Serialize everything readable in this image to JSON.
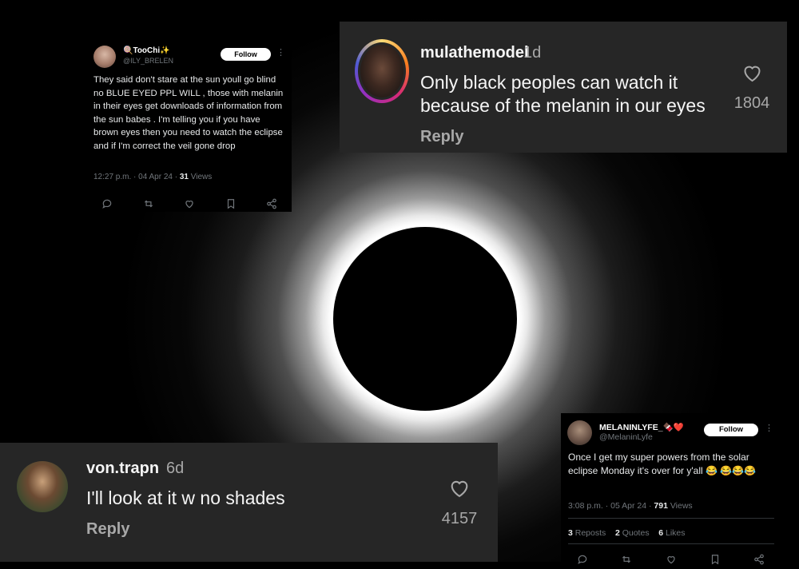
{
  "tweet1": {
    "name": "🍭TooChi✨",
    "handle": "@ILY_BRELEN",
    "follow_label": "Follow",
    "text": "They said don't stare at the sun youll go blind no BLUE EYED PPL WILL , those with melanin in their eyes get downloads of information from the sun babes . I'm telling you if you have brown eyes then you need to watch the eclipse and if I'm correct the veil gone drop",
    "time": "12:27 p.m. · 04 Apr 24 · ",
    "views_count": "31",
    "views_label": " Views"
  },
  "tweet2": {
    "name": "MELANINLYFE_🍫❤️",
    "handle": "@MelaninLyfe",
    "follow_label": "Follow",
    "text": "Once I get my super powers from the solar eclipse Monday it's over for y'all 😂 😂😂😂",
    "time": "3:08 p.m. · 05 Apr 24 · ",
    "views_count": "791",
    "views_label": " Views",
    "reposts_count": "3",
    "reposts_label": " Reposts",
    "quotes_count": "2",
    "quotes_label": " Quotes",
    "likes_count": "6",
    "likes_label": " Likes"
  },
  "comment1": {
    "username": "mulathemodel",
    "age": "1d",
    "text": "Only black peoples can watch it because of the melanin in our eyes",
    "reply_label": "Reply",
    "likes": "1804"
  },
  "comment2": {
    "username": "von.trapn",
    "age": "6d",
    "text": "I'll look at it w no shades",
    "reply_label": "Reply",
    "likes": "4157"
  },
  "icons": [
    "reply-icon",
    "retweet-icon",
    "like-icon",
    "bookmark-icon",
    "share-icon",
    "heart-icon",
    "more-icon"
  ],
  "colors": {
    "ig_card": "#262626",
    "tweet_card": "#000000",
    "ig_story_ring": "#d6249f"
  }
}
